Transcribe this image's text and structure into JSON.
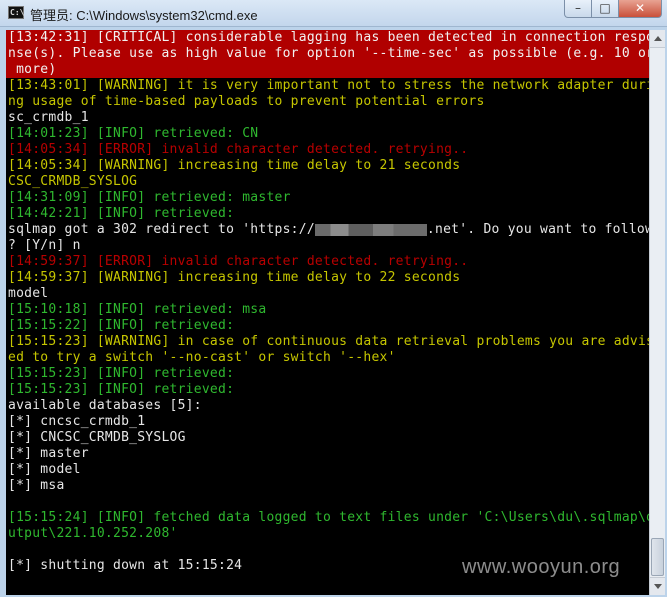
{
  "window": {
    "title": "管理员: C:\\Windows\\system32\\cmd.exe",
    "icon": "cmd-icon",
    "icon_text": "C:\\",
    "minimize_glyph": "–",
    "maximize_glyph": "□",
    "close_glyph": "✕"
  },
  "colors": {
    "critical_bg": "#b00000",
    "warning": "#c6c600",
    "info": "#2fb82f",
    "error": "#b80000",
    "normal": "#e6e6e6"
  },
  "console": {
    "lines": [
      {
        "type": "critical",
        "text": "[13:42:31] [CRITICAL] considerable lagging has been detected in connection respo"
      },
      {
        "type": "critical",
        "text": "nse(s). Please use as high value for option '--time-sec' as possible (e.g. 10 or"
      },
      {
        "type": "critical",
        "text": " more)"
      },
      {
        "type": "warning",
        "text": "[13:43:01] [WARNING] it is very important not to stress the network adapter duri"
      },
      {
        "type": "warning",
        "text": "ng usage of time-based payloads to prevent potential errors"
      },
      {
        "type": "normal",
        "text": "sc_crmdb_1"
      },
      {
        "type": "info",
        "text": "[14:01:23] [INFO] retrieved: CN"
      },
      {
        "type": "error",
        "text": "[14:05:34] [ERROR] invalid character detected. retrying.."
      },
      {
        "type": "warning",
        "text": "[14:05:34] [WARNING] increasing time delay to 21 seconds"
      },
      {
        "type": "warning",
        "text": "CSC_CRMDB_SYSLOG"
      },
      {
        "type": "info",
        "text": "[14:31:09] [INFO] retrieved: master"
      },
      {
        "type": "info",
        "text": "[14:42:21] [INFO] retrieved:"
      },
      {
        "type": "normal",
        "text": "sqlmap got a 302 redirect to 'https://",
        "redacted": true,
        "text_after": ".net'. Do you want to follow"
      },
      {
        "type": "normal",
        "text": "? [Y/n] n"
      },
      {
        "type": "error",
        "text": "[14:59:37] [ERROR] invalid character detected. retrying.."
      },
      {
        "type": "warning",
        "text": "[14:59:37] [WARNING] increasing time delay to 22 seconds"
      },
      {
        "type": "normal",
        "text": "model"
      },
      {
        "type": "info",
        "text": "[15:10:18] [INFO] retrieved: msa"
      },
      {
        "type": "info",
        "text": "[15:15:22] [INFO] retrieved:"
      },
      {
        "type": "warning",
        "text": "[15:15:23] [WARNING] in case of continuous data retrieval problems you are advis"
      },
      {
        "type": "warning",
        "text": "ed to try a switch '--no-cast' or switch '--hex'"
      },
      {
        "type": "info",
        "text": "[15:15:23] [INFO] retrieved:"
      },
      {
        "type": "info",
        "text": "[15:15:23] [INFO] retrieved:"
      },
      {
        "type": "normal",
        "text": "available databases [5]:"
      },
      {
        "type": "normal",
        "text": "[*] cncsc_crmdb_1"
      },
      {
        "type": "normal",
        "text": "[*] CNCSC_CRMDB_SYSLOG"
      },
      {
        "type": "normal",
        "text": "[*] master"
      },
      {
        "type": "normal",
        "text": "[*] model"
      },
      {
        "type": "normal",
        "text": "[*] msa"
      },
      {
        "type": "normal",
        "text": ""
      },
      {
        "type": "info",
        "text": "[15:15:24] [INFO] fetched data logged to text files under 'C:\\Users\\du\\.sqlmap\\o"
      },
      {
        "type": "info",
        "text": "utput\\221.10.252.208'"
      },
      {
        "type": "normal",
        "text": ""
      },
      {
        "type": "normal",
        "text": "[*] shutting down at 15:15:24"
      }
    ]
  },
  "watermark": "www.wooyun.org"
}
